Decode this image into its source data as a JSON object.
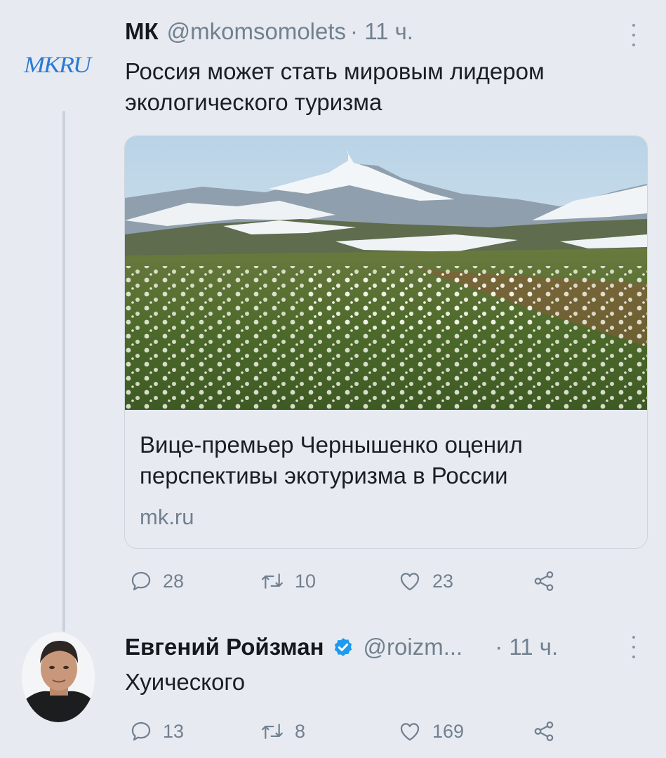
{
  "tweet1": {
    "logo_text": "MKRU",
    "author_name": "МК",
    "handle": "@mkomsomolets",
    "time": "· 11 ч.",
    "text": "Россия может стать мировым лидером экологического туризма",
    "card": {
      "title": "Вице-премьер Чернышенко оценил перспективы экотуризма в России",
      "domain": "mk.ru"
    },
    "actions": {
      "replies": "28",
      "retweets": "10",
      "likes": "23"
    }
  },
  "tweet2": {
    "author_name": "Евгений Ройзман",
    "handle": "@roizm...",
    "time": "· 11 ч.",
    "text": "Хуического",
    "actions": {
      "replies": "13",
      "retweets": "8",
      "likes": "169"
    }
  },
  "colors": {
    "background": "#e7ebf1",
    "secondary_text": "#72808f",
    "verified": "#1d9bf0",
    "logo": "#2b7bd3"
  },
  "icons": [
    "more-vertical-icon",
    "reply-icon",
    "retweet-icon",
    "like-icon",
    "share-icon",
    "verified-badge-icon"
  ]
}
